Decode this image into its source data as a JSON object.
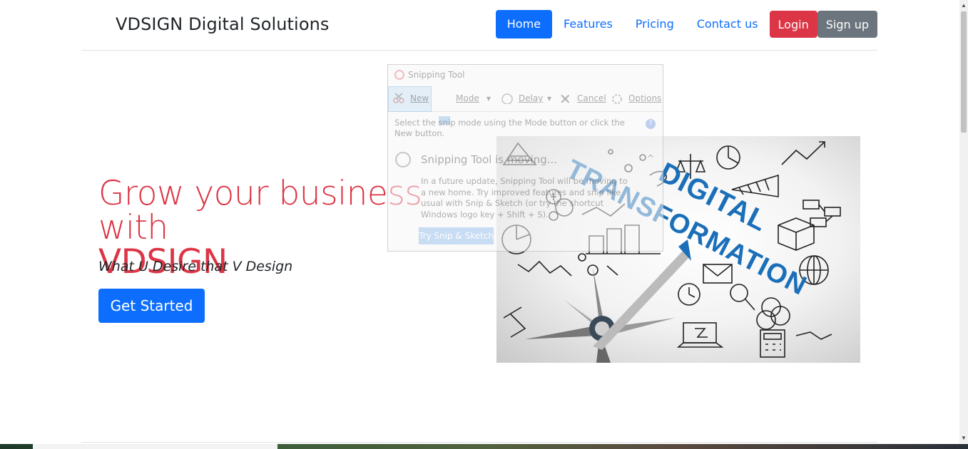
{
  "navbar": {
    "brand": "VDSIGN Digital Solutions",
    "links": [
      {
        "label": "Home",
        "active": true
      },
      {
        "label": "Features",
        "active": false
      },
      {
        "label": "Pricing",
        "active": false
      },
      {
        "label": "Contact us",
        "active": false
      }
    ],
    "login_label": "Login",
    "signup_label": "Sign up"
  },
  "hero": {
    "title_line1": "Grow your business with",
    "title_line2": "VDSIGN",
    "subtitle": "What U Desire that V Design",
    "cta_label": "Get Started"
  },
  "image_text": {
    "line1": "DIGITAL",
    "line2": "TRANSFORMATION"
  },
  "snipping_tool": {
    "title": "Snipping Tool",
    "toolbar": {
      "new_label": "New",
      "mode_label": "Mode",
      "delay_label": "Delay",
      "cancel_label": "Cancel",
      "options_label": "Options"
    },
    "message": "Select the snip mode using the Mode button or click the New button.",
    "notice_heading": "Snipping Tool is moving...",
    "notice_body": "In a future update, Snipping Tool will be moving to a new home. Try improved features and snip like usual with Snip & Sketch (or try the shortcut Windows logo key + Shift + S).",
    "notice_button": "Try Snip & Sketch"
  },
  "colors": {
    "primary": "#0d6efd",
    "danger": "#dc3545",
    "secondary": "#6c757d"
  }
}
